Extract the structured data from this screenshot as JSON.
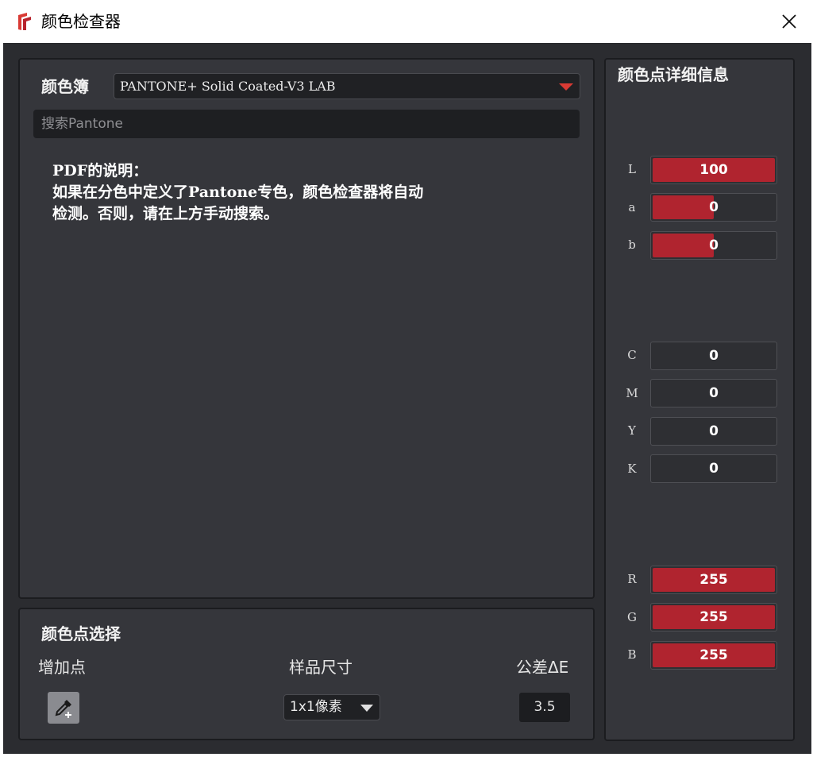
{
  "window": {
    "title": "颜色检查器"
  },
  "colorbook": {
    "label": "颜色簿",
    "selected": "PANTONE+ Solid Coated-V3 LAB",
    "search_placeholder": "搜索Pantone",
    "note_title": "PDF的说明：",
    "note_line1": "如果在分色中定义了Pantone专色，颜色检查器将自动",
    "note_line2": "检测。否则，请在上方手动搜索。"
  },
  "selection": {
    "title": "颜色点选择",
    "add_point_label": "增加点",
    "sample_size_label": "样品尺寸",
    "sample_size_value": "1x1像素",
    "tolerance_label": "公差ΔE",
    "tolerance_value": "3.5"
  },
  "details": {
    "title": "颜色点详细信息",
    "lab": [
      {
        "label": "L",
        "value": "100",
        "fill": 1.0
      },
      {
        "label": "a",
        "value": "0",
        "fill": 0.5
      },
      {
        "label": "b",
        "value": "0",
        "fill": 0.5
      }
    ],
    "cmyk": [
      {
        "label": "C",
        "value": "0",
        "fill": 0
      },
      {
        "label": "M",
        "value": "0",
        "fill": 0
      },
      {
        "label": "Y",
        "value": "0",
        "fill": 0
      },
      {
        "label": "K",
        "value": "0",
        "fill": 0
      }
    ],
    "rgb": [
      {
        "label": "R",
        "value": "255",
        "fill": 1.0
      },
      {
        "label": "G",
        "value": "255",
        "fill": 1.0
      },
      {
        "label": "B",
        "value": "255",
        "fill": 1.0
      }
    ]
  },
  "colors": {
    "accent_red": "#b0242f",
    "dropdown_arrow": "#d93a34",
    "background": "#2b2c30",
    "panel": "#35363b"
  },
  "icons": {
    "app": "app-logo-icon",
    "close": "close-icon",
    "dropdown": "chevron-down-icon",
    "eyedropper": "eyedropper-add-icon"
  }
}
